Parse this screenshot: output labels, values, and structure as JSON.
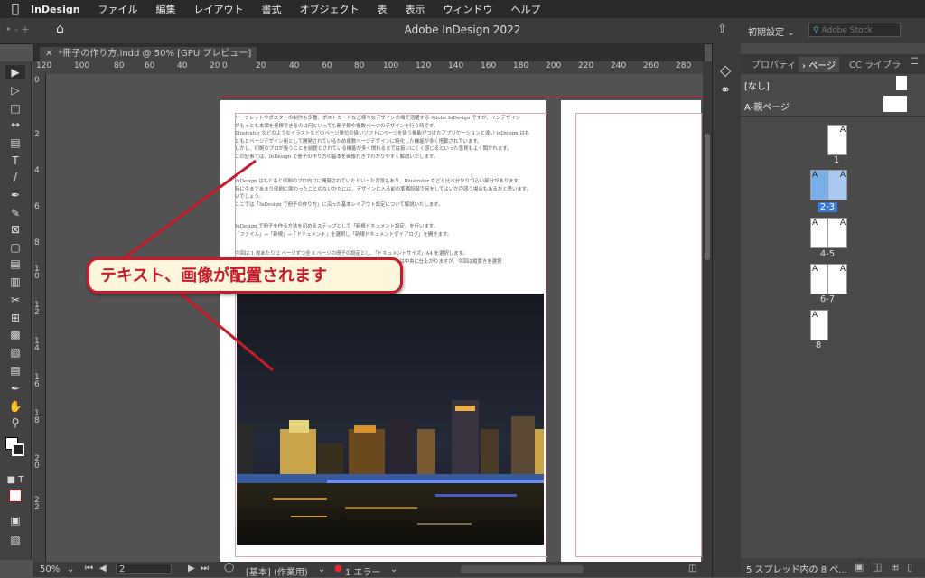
{
  "menubar": {
    "apple": "",
    "items": [
      "InDesign",
      "ファイル",
      "編集",
      "レイアウト",
      "書式",
      "オブジェクト",
      "表",
      "表示",
      "ウィンドウ",
      "ヘルプ"
    ]
  },
  "appbar": {
    "title": "Adobe InDesign 2022",
    "workspace": "初期設定",
    "stock_placeholder": "Adobe Stock"
  },
  "document_tab": "*冊子の作り方.indd @ 50% [GPU プレビュー]",
  "ruler": {
    "h_ticks": [
      "120",
      "100",
      "80",
      "60",
      "40",
      "20",
      "0",
      "20",
      "40",
      "60",
      "80",
      "100",
      "120",
      "140",
      "160",
      "180",
      "200",
      "220",
      "240",
      "260",
      "280"
    ],
    "v_ticks": [
      "0",
      "2",
      "4",
      "6",
      "8",
      "1\n0",
      "1\n2",
      "1\n4",
      "1\n6",
      "1\n8",
      "2\n0",
      "2\n2"
    ]
  },
  "document_text": {
    "para1": [
      "リーフレットやポスターの制作も多種、ポストカードなど様々なデザインの場で活躍する Adobe InDesign ですが、インデザイン",
      "がもっとも本領を発揮できるのは何といっても冊子類や複数ページのデザインを行う時です。",
      "Illustrator などのようなイラストなどのページ単位の扱いソフトにベージを扱う機能がつけたアプリケーションと違い inDesign はも",
      "ともとページデザイン用として開発されているため複数ページデザインに特化した機能が多く搭載されています。",
      "しかし、印刷のプロが扱うことを前提とされている機能が多く慣れるまでは扱いにくく感じるといった意見もよく聞かれます。",
      "この記事では、InDesign で冊子の作り方の基本を画像付きでわかりやすく解説いたします。"
    ],
    "para2": [
      "InDesign はもともと印刷のプロ向けに開発されていたといった背景もあり、Illustrator などと比べ分かりづらい部分があります。",
      "特に今まであまり印刷に関わったことのないかたには、デザインに入る前の準備段階で何をしてよいか戸惑う場合もあるかと思います。",
      "いでしょう。",
      "ここでは「InDesign で冊子の作り方」に沿った基本レイアウト設定について解説いたします。"
    ],
    "para3": [
      "InDesign で冊子を作る方法を初めるステップとして「新規ドキュメント設定」を行います。",
      "「ファイル」→「新規」→「ドキュメント」を選択し「新規ドキュメントダイアログ」を開きます。"
    ],
    "para4": [
      "今回は 1 枚あたり 2 ページずつ全 8 ページの冊子の設定とし、「ドキュメントサイズ」A4 を選択します。",
      "横置きの場合は中央に仕上がりますが、今回は縦置きを選択"
    ]
  },
  "callout": "テキスト、画像が配置されます",
  "statusbar": {
    "zoom": "50%",
    "page": "2",
    "style": "[基本] (作業用)",
    "errors": "1 エラー"
  },
  "panel": {
    "tabs": [
      "プロパティ",
      "ページ",
      "CC ライブラ"
    ],
    "none_label": "[なし]",
    "master_label": "A-親ページ",
    "spreads": [
      {
        "label": "1"
      },
      {
        "label": "2-3"
      },
      {
        "label": "4-5"
      },
      {
        "label": "6-7"
      },
      {
        "label": "8"
      }
    ],
    "master_letter": "A",
    "footer": "5 スプレッド内の 8 ペ..."
  },
  "colors": {
    "accent": "#c71c2b",
    "callout_bg": "#fdf5dc",
    "selection": "#4f8fd8"
  }
}
